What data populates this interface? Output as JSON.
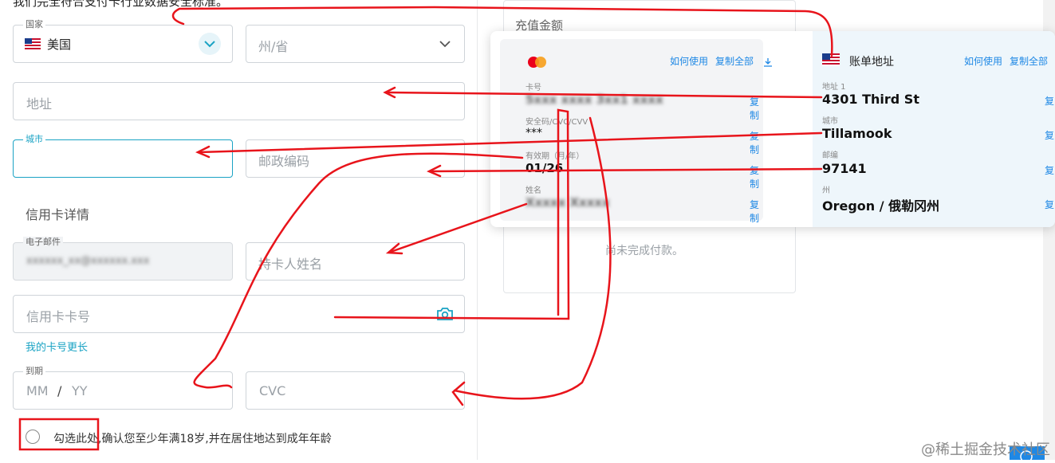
{
  "top_notice": "我们完全符合支付卡行业数据安全标准。",
  "form": {
    "country_label": "国家",
    "country_value": "美国",
    "state_placeholder": "州/省",
    "address_placeholder": "地址",
    "city_label": "城市",
    "zip_placeholder": "邮政编码",
    "card_section_title": "信用卡详情",
    "email_label": "电子邮件",
    "email_value": "xxxxxx_xx@xxxxxx.xxx",
    "holder_placeholder": "持卡人姓名",
    "card_number_placeholder": "信用卡卡号",
    "longer_card_link": "我的卡号更长",
    "expiry_label": "到期",
    "expiry_mm": "MM",
    "expiry_sep": "/",
    "expiry_yy": "YY",
    "cvc_placeholder": "CVC",
    "age_checkbox_label": "勾选此处,确认您至少年满18岁,并在居住地达到成年年龄"
  },
  "recharge": {
    "title": "充值金额",
    "empty_text": "尚未完成付款。"
  },
  "popup": {
    "card": {
      "how_to_use": "如何使用",
      "copy_all": "复制全部",
      "card_no_label": "卡号",
      "card_no_value": "5xxx xxxx 3xx1 xxxx",
      "cvc_label": "安全码/CVC/CVV",
      "cvc_value": "***",
      "expiry_label": "有效期（月/年）",
      "expiry_value": "01/26",
      "name_label": "姓名",
      "name_value": "Xxxxx Xxxxx",
      "copy": "复制"
    },
    "billing": {
      "title": "账单地址",
      "how_to_use": "如何使用",
      "copy_all": "复制全部",
      "address_label": "地址 1",
      "address_value": "4301 Third St",
      "city_label": "城市",
      "city_value": "Tillamook",
      "zip_label": "邮编",
      "zip_value": "97141",
      "state_label": "州",
      "state_value": "Oregon / 俄勒冈州",
      "copy": "复"
    }
  },
  "watermark": "@稀土掘金技术社区",
  "colors": {
    "accent": "#1aa3c4",
    "link": "#1e88e5",
    "annotation": "#e8141b",
    "mastercard_red": "#eb001b",
    "mastercard_yellow": "#f79e1b"
  }
}
